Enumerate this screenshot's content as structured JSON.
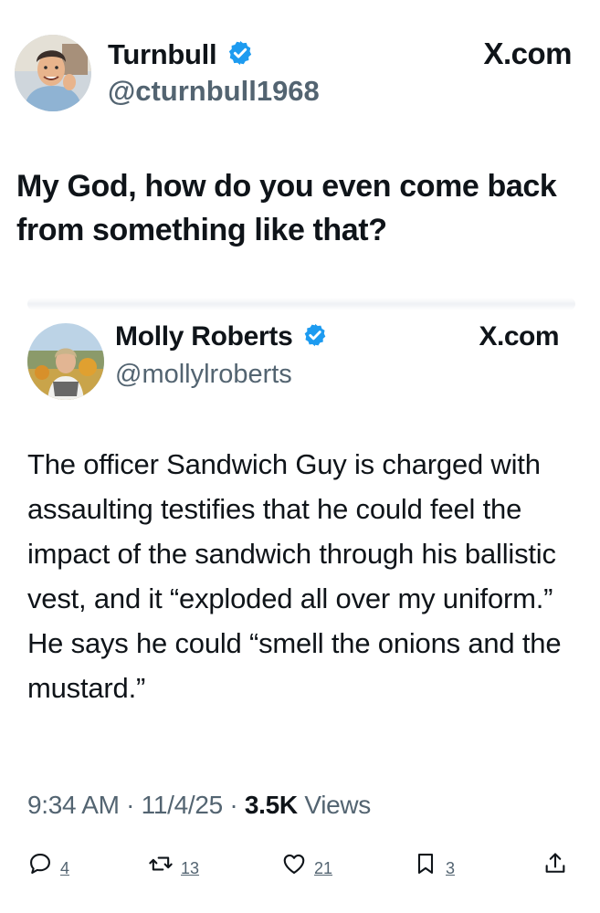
{
  "outer_post": {
    "display_name": "Turnbull",
    "handle": "@cturnbull1968",
    "brand": "X.com",
    "text": "My God, how do you even come back from something like that?"
  },
  "quoted_post": {
    "display_name": "Molly Roberts",
    "handle": "@mollylroberts",
    "brand": "X.com",
    "text": "The officer Sandwich Guy is charged with assaulting testifies that he could feel the impact of the sandwich through his ballistic vest, and it “exploded all over my uniform.” He says he could “smell the onions and the mustard.”",
    "time": "9:34 AM",
    "date": "11/4/25",
    "views_count": "3.5K",
    "views_label": "Views",
    "separator": "·",
    "replies": "4",
    "reposts": "13",
    "likes": "21",
    "bookmarks": "3"
  },
  "icons": {
    "verified": "verified-badge-icon",
    "reply": "reply-icon",
    "repost": "repost-icon",
    "like": "heart-icon",
    "bookmark": "bookmark-icon",
    "share": "share-icon"
  },
  "colors": {
    "verified_blue": "#1d9bf0",
    "secondary_text": "#536471",
    "primary_text": "#0f1419"
  }
}
